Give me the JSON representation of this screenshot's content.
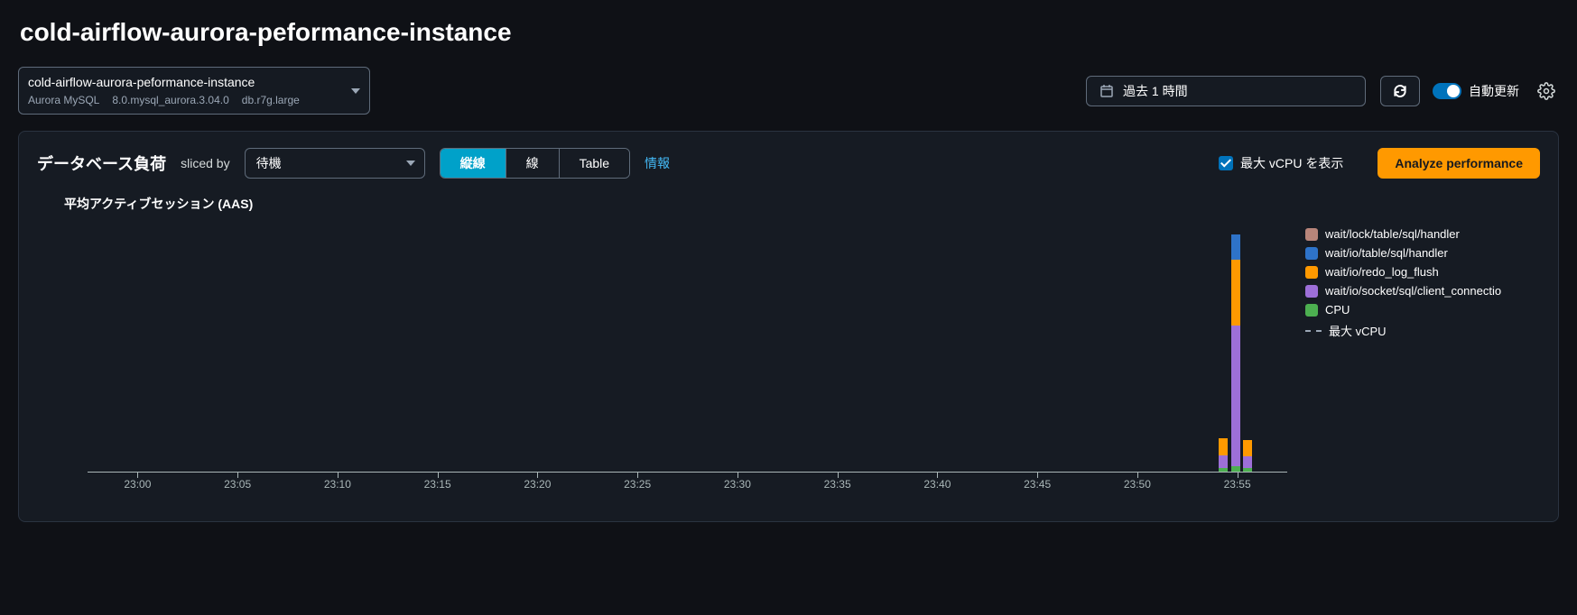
{
  "page_title": "cold-airflow-aurora-peformance-instance",
  "instance_picker": {
    "name": "cold-airflow-aurora-peformance-instance",
    "engine": "Aurora MySQL",
    "version": "8.0.mysql_aurora.3.04.0",
    "class": "db.r7g.large"
  },
  "time_range": {
    "label": "過去 1 時間"
  },
  "auto_refresh": {
    "label": "自動更新",
    "on": true
  },
  "panel": {
    "title": "データベース負荷",
    "sliced_by_label": "sliced by",
    "sliced_by_value": "待機",
    "view_modes": {
      "stacked": "縦線",
      "line": "線",
      "table": "Table"
    },
    "info_link": "情報",
    "show_vcpu_label": "最大 vCPU を表示",
    "analyze_button": "Analyze performance"
  },
  "chart_data": {
    "type": "bar",
    "title": "平均アクティブセッション (AAS)",
    "xlabel": "",
    "ylabel": "",
    "ylim": [
      0,
      3.0
    ],
    "categories": [
      "23:00",
      "23:05",
      "23:10",
      "23:15",
      "23:20",
      "23:25",
      "23:30",
      "23:35",
      "23:40",
      "23:45",
      "23:50",
      "23:55"
    ],
    "series": [
      {
        "name": "wait/lock/table/sql/handler",
        "color": "#b8857a"
      },
      {
        "name": "wait/io/table/sql/handler",
        "color": "#2e73c9"
      },
      {
        "name": "wait/io/redo_log_flush",
        "color": "#ff9900"
      },
      {
        "name": "wait/io/socket/sql/client_connectio",
        "color": "#9d6fd8"
      },
      {
        "name": "CPU",
        "color": "#4caf50"
      },
      {
        "name": "最大 vCPU",
        "color": "dash"
      }
    ],
    "bars": [
      {
        "x_offset_pct": 94.3,
        "stacks": [
          {
            "series": 4,
            "h": 0.04
          },
          {
            "series": 3,
            "h": 0.16
          },
          {
            "series": 2,
            "h": 0.2
          }
        ]
      },
      {
        "x_offset_pct": 95.3,
        "stacks": [
          {
            "series": 4,
            "h": 0.06
          },
          {
            "series": 3,
            "h": 1.7
          },
          {
            "series": 2,
            "h": 0.8
          },
          {
            "series": 1,
            "h": 0.3
          }
        ]
      },
      {
        "x_offset_pct": 96.3,
        "stacks": [
          {
            "series": 4,
            "h": 0.04
          },
          {
            "series": 3,
            "h": 0.14
          },
          {
            "series": 2,
            "h": 0.2
          }
        ]
      }
    ]
  }
}
